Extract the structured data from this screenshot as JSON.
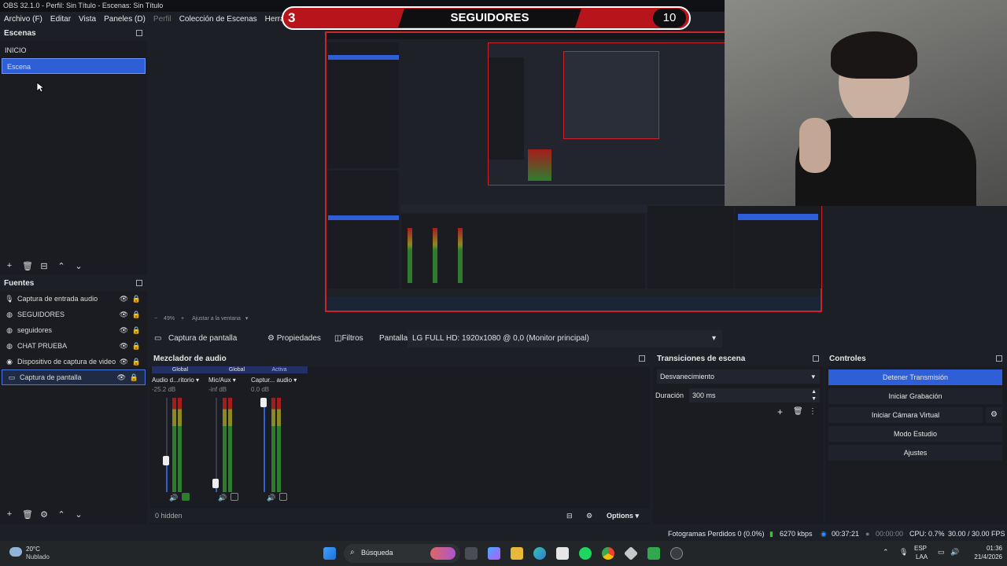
{
  "window_title": "OBS 32.1.0 - Perfil: Sin Título - Escenas: Sin Título",
  "menu": [
    "Archivo (F)",
    "Editar",
    "Vista",
    "Paneles (D)",
    "Perfil",
    "Colección de Escenas",
    "Herramientas"
  ],
  "overlay": {
    "left_number": "3",
    "label": "SEGUIDORES",
    "right_number": "10"
  },
  "scenes": {
    "title": "Escenas",
    "items": [
      "INICIO",
      "Escena"
    ],
    "selected_index": 1
  },
  "sources": {
    "title": "Fuentes",
    "items": [
      {
        "label": "Captura de entrada audio",
        "icon": "microphone-icon"
      },
      {
        "label": "SEGUIDORES",
        "icon": "globe-icon"
      },
      {
        "label": "seguidores",
        "icon": "globe-icon"
      },
      {
        "label": "CHAT PRUEBA",
        "icon": "globe-icon"
      },
      {
        "label": "Dispositivo de captura de video",
        "icon": "camera-icon"
      },
      {
        "label": "Captura de pantalla",
        "icon": "monitor-icon"
      }
    ],
    "selected_index": 5
  },
  "preview_footer": {
    "zoom": "49%",
    "fit": "Ajustar a la ventana"
  },
  "properties_bar": {
    "source_name": "Captura de pantalla",
    "properties": "Propiedades",
    "filters": "Filtros",
    "screen_label": "Pantalla",
    "screen_value": "LG FULL HD: 1920x1080 @ 0,0 (Monitor principal)"
  },
  "mixer": {
    "title": "Mezclador de audio",
    "channels": [
      {
        "badge": "Global",
        "name": "Audio d...ritorio",
        "db": "-25.2 dB",
        "fader_level": 0.35
      },
      {
        "badge": "Global",
        "name": "Mic/Aux",
        "db": "-inf dB",
        "fader_level": 0.1
      },
      {
        "badge": "Activa",
        "name": "Captur... audio",
        "db": "0.0 dB",
        "fader_level": 1.0
      }
    ],
    "scale": [
      "0",
      "-6",
      "-12",
      "-18",
      "-24",
      "-30",
      "-36",
      "-42",
      "-48",
      "-54",
      "-60"
    ],
    "hidden": "0 hidden",
    "options": "Options"
  },
  "transitions": {
    "title": "Transiciones de escena",
    "type": "Desvanecimiento",
    "duration_label": "Duración",
    "duration_value": "300 ms"
  },
  "controls": {
    "title": "Controles",
    "buttons": [
      "Detener Transmisión",
      "Iniciar Grabación",
      "Iniciar Cámara Virtual",
      "Modo Estudio",
      "Ajustes"
    ]
  },
  "status": {
    "dropped": "Fotogramas Perdidos 0 (0.0%)",
    "bitrate": "6270 kbps",
    "stream_time": "00:37:21",
    "rec_time": "00:00:00",
    "cpu": "CPU: 0.7%",
    "fps": "30.00 / 30.00 FPS"
  },
  "taskbar": {
    "weather_temp": "20°C",
    "weather_desc": "Nublado",
    "search": "Búsqueda",
    "lang": "ESP",
    "lang2": "LAA",
    "time": "01:36",
    "date": "21/4/2026"
  },
  "colors": {
    "accent": "#2f5fd6",
    "overlay_red": "#b8141c",
    "preview_border": "#c9232c"
  }
}
